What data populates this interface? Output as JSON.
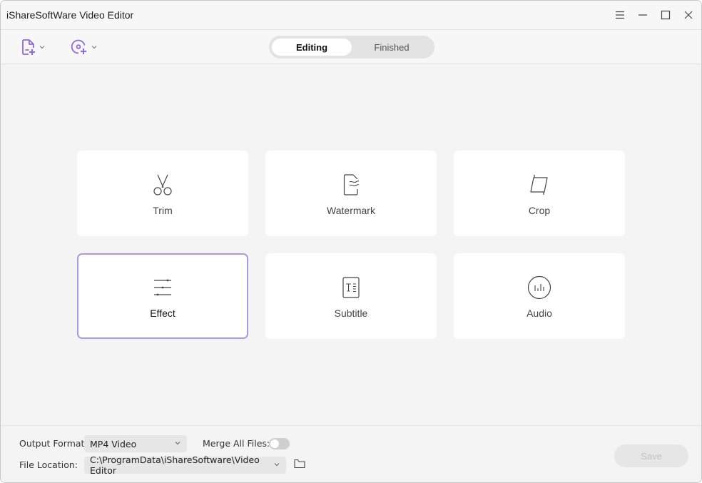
{
  "window": {
    "title": "iShareSoftWare Video Editor",
    "controls": [
      "menu-icon",
      "minimize-icon",
      "maximize-icon",
      "close-icon"
    ]
  },
  "toolbar": {
    "add_file_icon": "add-file-icon",
    "add_dvd_icon": "add-dvd-icon",
    "tabs": [
      {
        "label": "Editing",
        "active": true
      },
      {
        "label": "Finished",
        "active": false
      }
    ]
  },
  "tools": [
    {
      "label": "Trim",
      "icon": "scissors-icon",
      "selected": false
    },
    {
      "label": "Watermark",
      "icon": "watermark-icon",
      "selected": false
    },
    {
      "label": "Crop",
      "icon": "crop-icon",
      "selected": false
    },
    {
      "label": "Effect",
      "icon": "effect-sliders-icon",
      "selected": true
    },
    {
      "label": "Subtitle",
      "icon": "subtitle-icon",
      "selected": false
    },
    {
      "label": "Audio",
      "icon": "audio-icon",
      "selected": false
    }
  ],
  "footer": {
    "output_format_label": "Output Format:",
    "output_format_value": "MP4 Video",
    "merge_label": "Merge All Files:",
    "merge_enabled": false,
    "file_location_label": "File Location:",
    "file_location_value": "C:\\ProgramData\\iShareSoftware\\Video Editor",
    "save_label": "Save"
  },
  "colors": {
    "accent": "#8f6ad8",
    "selected_border": "#ad98e6"
  }
}
